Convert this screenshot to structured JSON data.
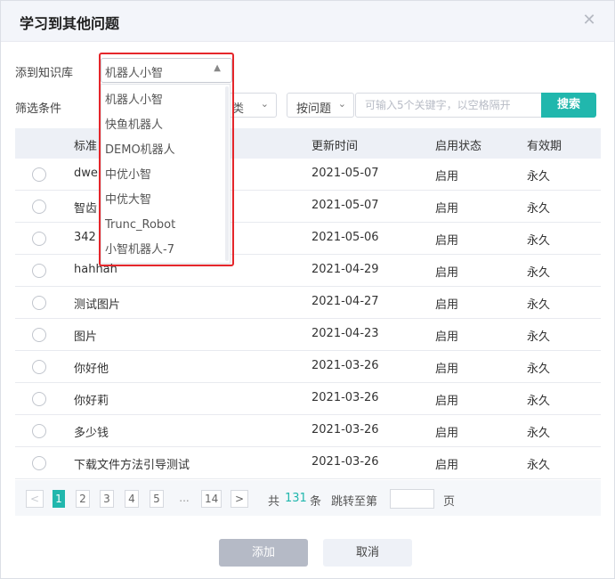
{
  "dialog": {
    "title": "学习到其他问题",
    "close_icon": "close-icon"
  },
  "form": {
    "kb_label": "添到知识库",
    "kb_selected": "机器人小智",
    "filter_label": "筛选条件",
    "filter_category_tail": "类",
    "filter_type": "按问题",
    "search_placeholder": "可输入5个关键字，以空格隔开",
    "search_button": "搜索"
  },
  "dropdown": {
    "options": [
      "机器人小智",
      "快鱼机器人",
      "DEMO机器人",
      "中优小智",
      "中优大智",
      "Trunc_Robot",
      "小智机器人-7"
    ]
  },
  "table": {
    "headers": [
      "标准问题",
      "更新时间",
      "启用状态",
      "有效期"
    ],
    "header_visible_first": "标准",
    "rows": [
      {
        "question": "dwe",
        "date": "2021-05-07",
        "status": "启用",
        "validity": "永久"
      },
      {
        "question": "智齿",
        "date": "2021-05-07",
        "status": "启用",
        "validity": "永久"
      },
      {
        "question": "342",
        "date": "2021-05-06",
        "status": "启用",
        "validity": "永久"
      },
      {
        "question": "hahhah",
        "date": "2021-04-29",
        "status": "启用",
        "validity": "永久"
      },
      {
        "question": "测试图片",
        "date": "2021-04-27",
        "status": "启用",
        "validity": "永久"
      },
      {
        "question": "图片",
        "date": "2021-04-23",
        "status": "启用",
        "validity": "永久"
      },
      {
        "question": "你好他",
        "date": "2021-03-26",
        "status": "启用",
        "validity": "永久"
      },
      {
        "question": "你好莉",
        "date": "2021-03-26",
        "status": "启用",
        "validity": "永久"
      },
      {
        "question": "多少钱",
        "date": "2021-03-26",
        "status": "启用",
        "validity": "永久"
      },
      {
        "question": "下载文件方法引导测试",
        "date": "2021-03-26",
        "status": "启用",
        "validity": "永久"
      }
    ]
  },
  "pagination": {
    "prev": "<",
    "next": ">",
    "pages": [
      "1",
      "2",
      "3",
      "4",
      "5",
      "...",
      "14"
    ],
    "current": "1",
    "total_prefix": "共",
    "total_count": "131",
    "total_suffix": "条",
    "jump_label": "跳转至第",
    "jump_suffix": "页"
  },
  "footer": {
    "confirm": "添加",
    "cancel": "取消"
  },
  "colors": {
    "accent": "#21b7ad",
    "highlight": "#e5262b",
    "disabled_button": "#b5bac6"
  }
}
